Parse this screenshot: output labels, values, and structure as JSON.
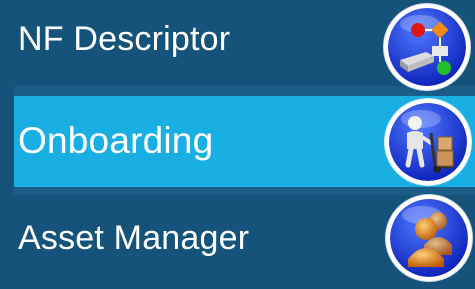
{
  "menu": {
    "items": [
      {
        "label": "NF Descriptor",
        "icon": "workflow-server-icon",
        "selected": false
      },
      {
        "label": "Onboarding",
        "icon": "person-handtruck-icon",
        "selected": true
      },
      {
        "label": "Asset Manager",
        "icon": "user-group-icon",
        "selected": false
      }
    ]
  },
  "colors": {
    "background": "#1a5d86",
    "item": "#16537a",
    "selected_item": "#1aafe2",
    "icon_blue": "#1f3fd6",
    "text": "#ffffff"
  }
}
